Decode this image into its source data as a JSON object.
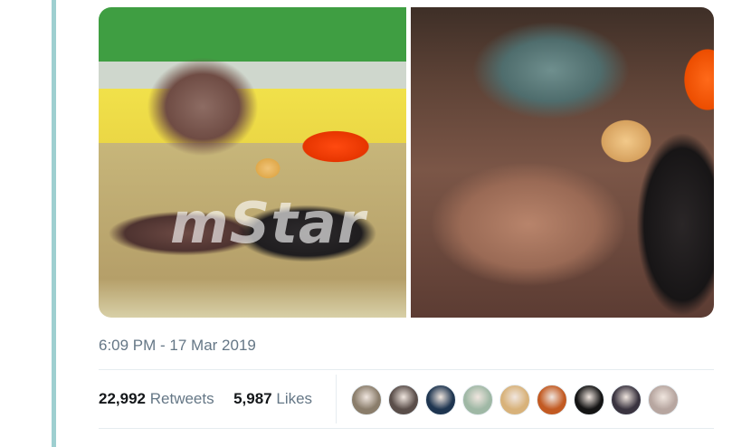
{
  "tweet": {
    "timestamp": "6:09 PM - 17 Mar 2019",
    "retweets_count": "22,992",
    "retweets_label": "Retweets",
    "likes_count": "5,987",
    "likes_label": "Likes"
  },
  "media": {
    "watermark": "mStar"
  },
  "avatars": [
    {
      "name": "retweeter-avatar-1",
      "color": "#8a7d6b"
    },
    {
      "name": "retweeter-avatar-2",
      "color": "#5a4e4a"
    },
    {
      "name": "retweeter-avatar-3",
      "color": "#1e3550"
    },
    {
      "name": "retweeter-avatar-4",
      "color": "#9fb8a5"
    },
    {
      "name": "retweeter-avatar-5",
      "color": "#d8b27a"
    },
    {
      "name": "retweeter-avatar-6",
      "color": "#c25a22"
    },
    {
      "name": "retweeter-avatar-7",
      "color": "#141414"
    },
    {
      "name": "retweeter-avatar-8",
      "color": "#3a3440"
    },
    {
      "name": "retweeter-avatar-9",
      "color": "#b7a6a0"
    }
  ]
}
